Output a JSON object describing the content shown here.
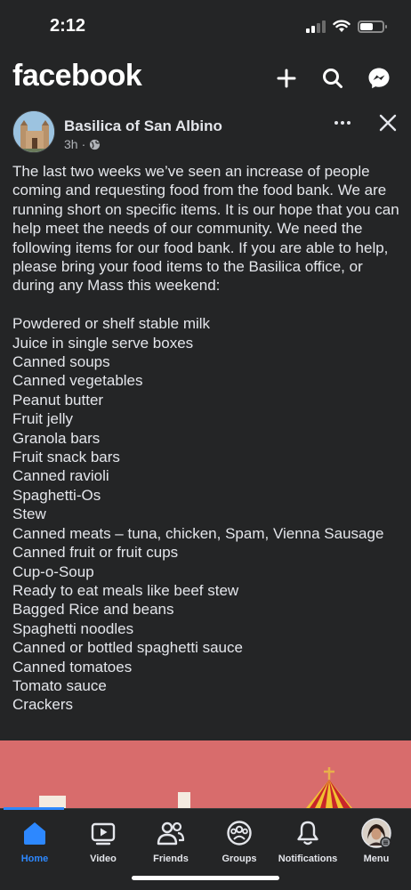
{
  "status_bar": {
    "time": "2:12"
  },
  "header": {
    "logo": "facebook",
    "icons": [
      "plus-icon",
      "search-icon",
      "messenger-icon"
    ]
  },
  "post": {
    "author": "Basilica of San Albino",
    "time": "3h",
    "separator": "·",
    "intro": "The last two weeks we’ve seen an increase of people coming and requesting food from the food bank. We are running short on specific items. It is our hope that you can help meet the needs of our community. We need the following items for our food bank. If you are able to help, please bring your food items to the Basilica office, or during any Mass this weekend:",
    "items": [
      "Powdered or shelf stable milk",
      "Juice in single serve boxes",
      "Canned soups",
      "Canned vegetables",
      "Peanut butter",
      "Fruit jelly",
      "Granola bars",
      "Fruit snack bars",
      "Canned ravioli",
      "Spaghetti-Os",
      "Stew",
      "Canned meats – tuna, chicken, Spam, Vienna Sausage",
      "Canned fruit or fruit cups",
      "Cup-o-Soup",
      "Ready to eat meals like beef stew",
      "Bagged Rice and beans",
      "Spaghetti noodles",
      "Canned or bottled spaghetti sauce",
      "Canned tomatoes",
      "Tomato sauce",
      "Crackers"
    ]
  },
  "tabs": [
    {
      "label": "Home",
      "icon": "home-icon",
      "active": true
    },
    {
      "label": "Video",
      "icon": "video-icon",
      "active": false
    },
    {
      "label": "Friends",
      "icon": "friends-icon",
      "active": false
    },
    {
      "label": "Groups",
      "icon": "groups-icon",
      "active": false
    },
    {
      "label": "Notifications",
      "icon": "bell-icon",
      "active": false
    },
    {
      "label": "Menu",
      "icon": "profile-avatar",
      "active": false
    }
  ],
  "colors": {
    "background": "#242526",
    "accent": "#2d88ff",
    "text": "#e4e6eb",
    "secondary_text": "#b0b3b8",
    "image_bg": "#d86c6c"
  }
}
